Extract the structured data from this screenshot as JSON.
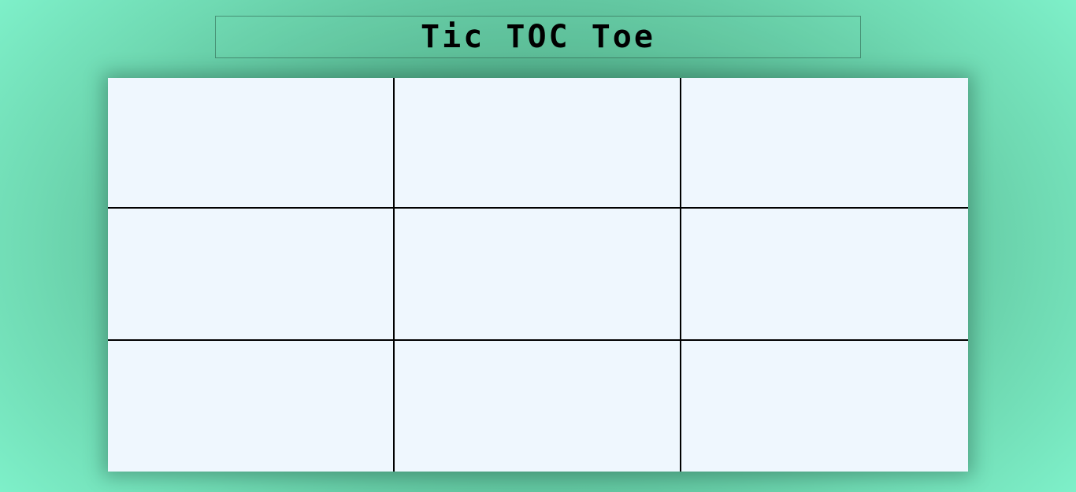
{
  "header": {
    "title": "Tic TOC Toe"
  },
  "board": {
    "rows": 3,
    "cols": 3,
    "cells": [
      "",
      "",
      "",
      "",
      "",
      "",
      "",
      "",
      ""
    ]
  },
  "colors": {
    "background_center": "#3f8e6c",
    "background_edge": "#7ef0c9",
    "board_fill": "#eff7fe",
    "grid_lines": "#000000"
  }
}
